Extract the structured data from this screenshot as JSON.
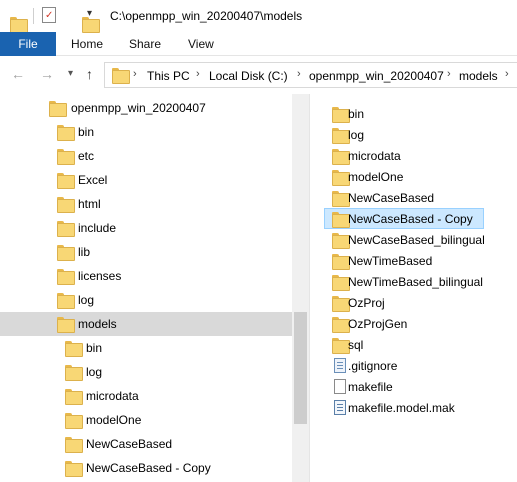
{
  "window": {
    "title": "C:\\openmpp_win_20200407\\models"
  },
  "ribbon": {
    "file": "File",
    "home": "Home",
    "share": "Share",
    "view": "View"
  },
  "address": {
    "crumbs": [
      "This PC",
      "Local Disk (C:)",
      "openmpp_win_20200407",
      "models"
    ]
  },
  "tree": {
    "root": "openmpp_win_20200407",
    "items": [
      "bin",
      "etc",
      "Excel",
      "html",
      "include",
      "lib",
      "licenses",
      "log",
      "models"
    ],
    "sub_items": [
      "bin",
      "log",
      "microdata",
      "modelOne",
      "NewCaseBased",
      "NewCaseBased - Copy"
    ]
  },
  "content": {
    "items": [
      {
        "name": "bin",
        "icon": "folder-icon"
      },
      {
        "name": "log",
        "icon": "folder-icon"
      },
      {
        "name": "microdata",
        "icon": "folder-icon"
      },
      {
        "name": "modelOne",
        "icon": "folder-icon"
      },
      {
        "name": "NewCaseBased",
        "icon": "folder-icon"
      },
      {
        "name": "NewCaseBased - Copy",
        "icon": "folder-icon"
      },
      {
        "name": "NewCaseBased_bilingual",
        "icon": "folder-icon"
      },
      {
        "name": "NewTimeBased",
        "icon": "folder-icon"
      },
      {
        "name": "NewTimeBased_bilingual",
        "icon": "folder-icon"
      },
      {
        "name": "OzProj",
        "icon": "folder-icon"
      },
      {
        "name": "OzProjGen",
        "icon": "folder-icon"
      },
      {
        "name": "sql",
        "icon": "folder-icon"
      },
      {
        "name": ".gitignore",
        "icon": "text-file-icon"
      },
      {
        "name": "makefile",
        "icon": "file-icon"
      },
      {
        "name": "makefile.model.mak",
        "icon": "text-file-icon"
      }
    ]
  },
  "colors": {
    "file_tab": "#1a63b0",
    "selection": "#cce8ff",
    "tree_selection": "#d9d9d9",
    "folder": "#f8d775"
  }
}
